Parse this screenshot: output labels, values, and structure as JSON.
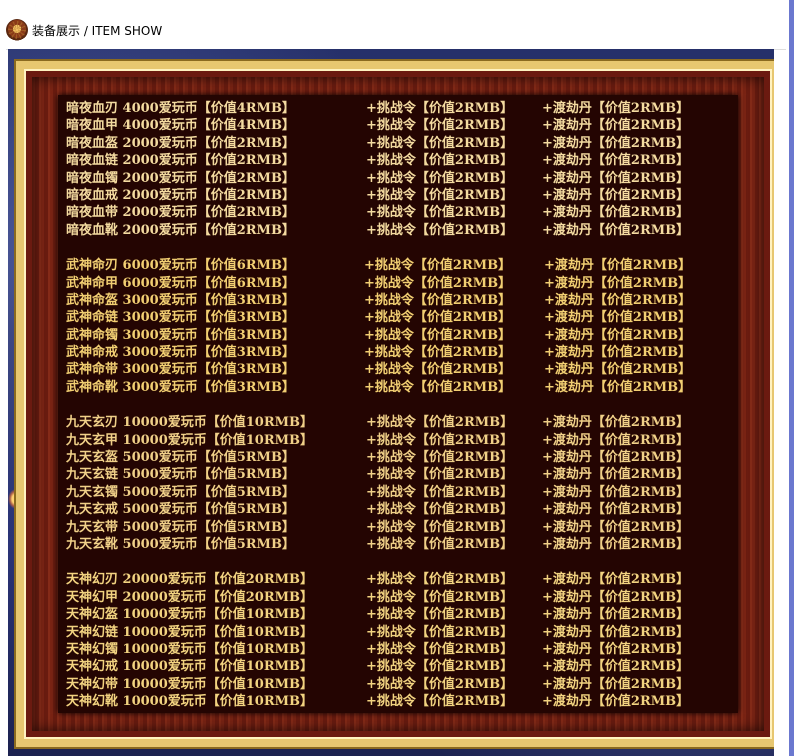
{
  "header": {
    "title": "装备展示 / ITEM SHOW",
    "icon": "emblem-icon"
  },
  "groups": [
    {
      "rows": [
        [
          "暗夜血刃 4000爱玩币【价值4RMB】",
          "+挑战令【价值2RMB】",
          "+渡劫丹【价值2RMB】"
        ],
        [
          "暗夜血甲 4000爱玩币【价值4RMB】",
          "+挑战令【价值2RMB】",
          "+渡劫丹【价值2RMB】"
        ],
        [
          "暗夜血盔 2000爱玩币【价值2RMB】",
          "+挑战令【价值2RMB】",
          "+渡劫丹【价值2RMB】"
        ],
        [
          "暗夜血链 2000爱玩币【价值2RMB】",
          "+挑战令【价值2RMB】",
          "+渡劫丹【价值2RMB】"
        ],
        [
          "暗夜血镯 2000爱玩币【价值2RMB】",
          "+挑战令【价值2RMB】",
          "+渡劫丹【价值2RMB】"
        ],
        [
          "暗夜血戒 2000爱玩币【价值2RMB】",
          "+挑战令【价值2RMB】",
          "+渡劫丹【价值2RMB】"
        ],
        [
          "暗夜血带 2000爱玩币【价值2RMB】",
          "+挑战令【价值2RMB】",
          "+渡劫丹【价值2RMB】"
        ],
        [
          "暗夜血靴 2000爱玩币【价值2RMB】",
          "+挑战令【价值2RMB】",
          "+渡劫丹【价值2RMB】"
        ]
      ]
    },
    {
      "rows": [
        [
          "武神命刃 6000爱玩币【价值6RMB】",
          "+挑战令【价值2RMB】",
          "+渡劫丹【价值2RMB】"
        ],
        [
          "武神命甲 6000爱玩币【价值6RMB】",
          "+挑战令【价值2RMB】",
          "+渡劫丹【价值2RMB】"
        ],
        [
          "武神命盔 3000爱玩币【价值3RMB】",
          "+挑战令【价值2RMB】",
          "+渡劫丹【价值2RMB】"
        ],
        [
          "武神命链 3000爱玩币【价值3RMB】",
          "+挑战令【价值2RMB】",
          "+渡劫丹【价值2RMB】"
        ],
        [
          "武神命镯 3000爱玩币【价值3RMB】",
          "+挑战令【价值2RMB】",
          "+渡劫丹【价值2RMB】"
        ],
        [
          "武神命戒 3000爱玩币【价值3RMB】",
          "+挑战令【价值2RMB】",
          "+渡劫丹【价值2RMB】"
        ],
        [
          "武神命带 3000爱玩币【价值3RMB】",
          "+挑战令【价值2RMB】",
          "+渡劫丹【价值2RMB】"
        ],
        [
          "武神命靴 3000爱玩币【价值3RMB】",
          "+挑战令【价值2RMB】",
          "+渡劫丹【价值2RMB】"
        ]
      ]
    },
    {
      "rows": [
        [
          "九天玄刃 10000爱玩币【价值10RMB】",
          "+挑战令【价值2RMB】",
          "+渡劫丹【价值2RMB】"
        ],
        [
          "九天玄甲 10000爱玩币【价值10RMB】",
          "+挑战令【价值2RMB】",
          "+渡劫丹【价值2RMB】"
        ],
        [
          "九天玄盔 5000爱玩币【价值5RMB】",
          "+挑战令【价值2RMB】",
          "+渡劫丹【价值2RMB】"
        ],
        [
          "九天玄链 5000爱玩币【价值5RMB】",
          "+挑战令【价值2RMB】",
          "+渡劫丹【价值2RMB】"
        ],
        [
          "九天玄镯 5000爱玩币【价值5RMB】",
          "+挑战令【价值2RMB】",
          "+渡劫丹【价值2RMB】"
        ],
        [
          "九天玄戒 5000爱玩币【价值5RMB】",
          "+挑战令【价值2RMB】",
          "+渡劫丹【价值2RMB】"
        ],
        [
          "九天玄带 5000爱玩币【价值5RMB】",
          "+挑战令【价值2RMB】",
          "+渡劫丹【价值2RMB】"
        ],
        [
          "九天玄靴 5000爱玩币【价值5RMB】",
          "+挑战令【价值2RMB】",
          "+渡劫丹【价值2RMB】"
        ]
      ]
    },
    {
      "rows": [
        [
          "天神幻刃 20000爱玩币【价值20RMB】",
          "+挑战令【价值2RMB】",
          "+渡劫丹【价值2RMB】"
        ],
        [
          "天神幻甲 20000爱玩币【价值20RMB】",
          "+挑战令【价值2RMB】",
          "+渡劫丹【价值2RMB】"
        ],
        [
          "天神幻盔 10000爱玩币【价值10RMB】",
          "+挑战令【价值2RMB】",
          "+渡劫丹【价值2RMB】"
        ],
        [
          "天神幻链 10000爱玩币【价值10RMB】",
          "+挑战令【价值2RMB】",
          "+渡劫丹【价值2RMB】"
        ],
        [
          "天神幻镯 10000爱玩币【价值10RMB】",
          "+挑战令【价值2RMB】",
          "+渡劫丹【价值2RMB】"
        ],
        [
          "天神幻戒 10000爱玩币【价值10RMB】",
          "+挑战令【价值2RMB】",
          "+渡劫丹【价值2RMB】"
        ],
        [
          "天神幻带 10000爱玩币【价值10RMB】",
          "+挑战令【价值2RMB】",
          "+渡劫丹【价值2RMB】"
        ],
        [
          "天神幻靴 10000爱玩币【价值10RMB】",
          "+挑战令【价值2RMB】",
          "+渡劫丹【价值2RMB】"
        ]
      ]
    }
  ]
}
